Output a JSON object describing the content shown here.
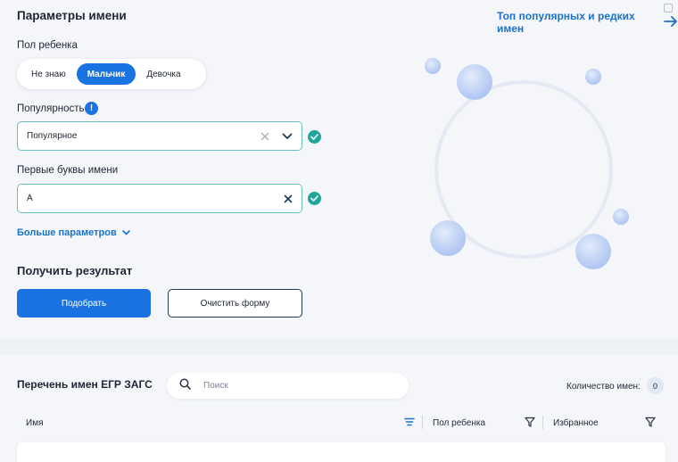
{
  "header": {
    "title": "Параметры имени",
    "top_link": "Топ популярных и редких имен"
  },
  "gender": {
    "label": "Пол ребенка",
    "options": [
      "Не знаю",
      "Мальчик",
      "Девочка"
    ],
    "selected": "Мальчик"
  },
  "popularity": {
    "label": "Популярность",
    "info": "!",
    "value": "Популярное"
  },
  "letters": {
    "label": "Первые буквы имени",
    "value": "А"
  },
  "more_params": "Больше параметров",
  "result": {
    "title": "Получить результат",
    "submit": "Подобрать",
    "clear": "Очистить форму"
  },
  "list": {
    "title": "Перечень имен ЕГР ЗАГС",
    "search_placeholder": "Поиск",
    "count_label": "Количество имен:",
    "count_value": "0",
    "columns": [
      "Имя",
      "Пол ребенка",
      "Избранное"
    ]
  },
  "colors": {
    "accent": "#1a73e0",
    "link": "#1a73c8",
    "success": "#21a59b",
    "field_border": "#6cbdbd"
  }
}
